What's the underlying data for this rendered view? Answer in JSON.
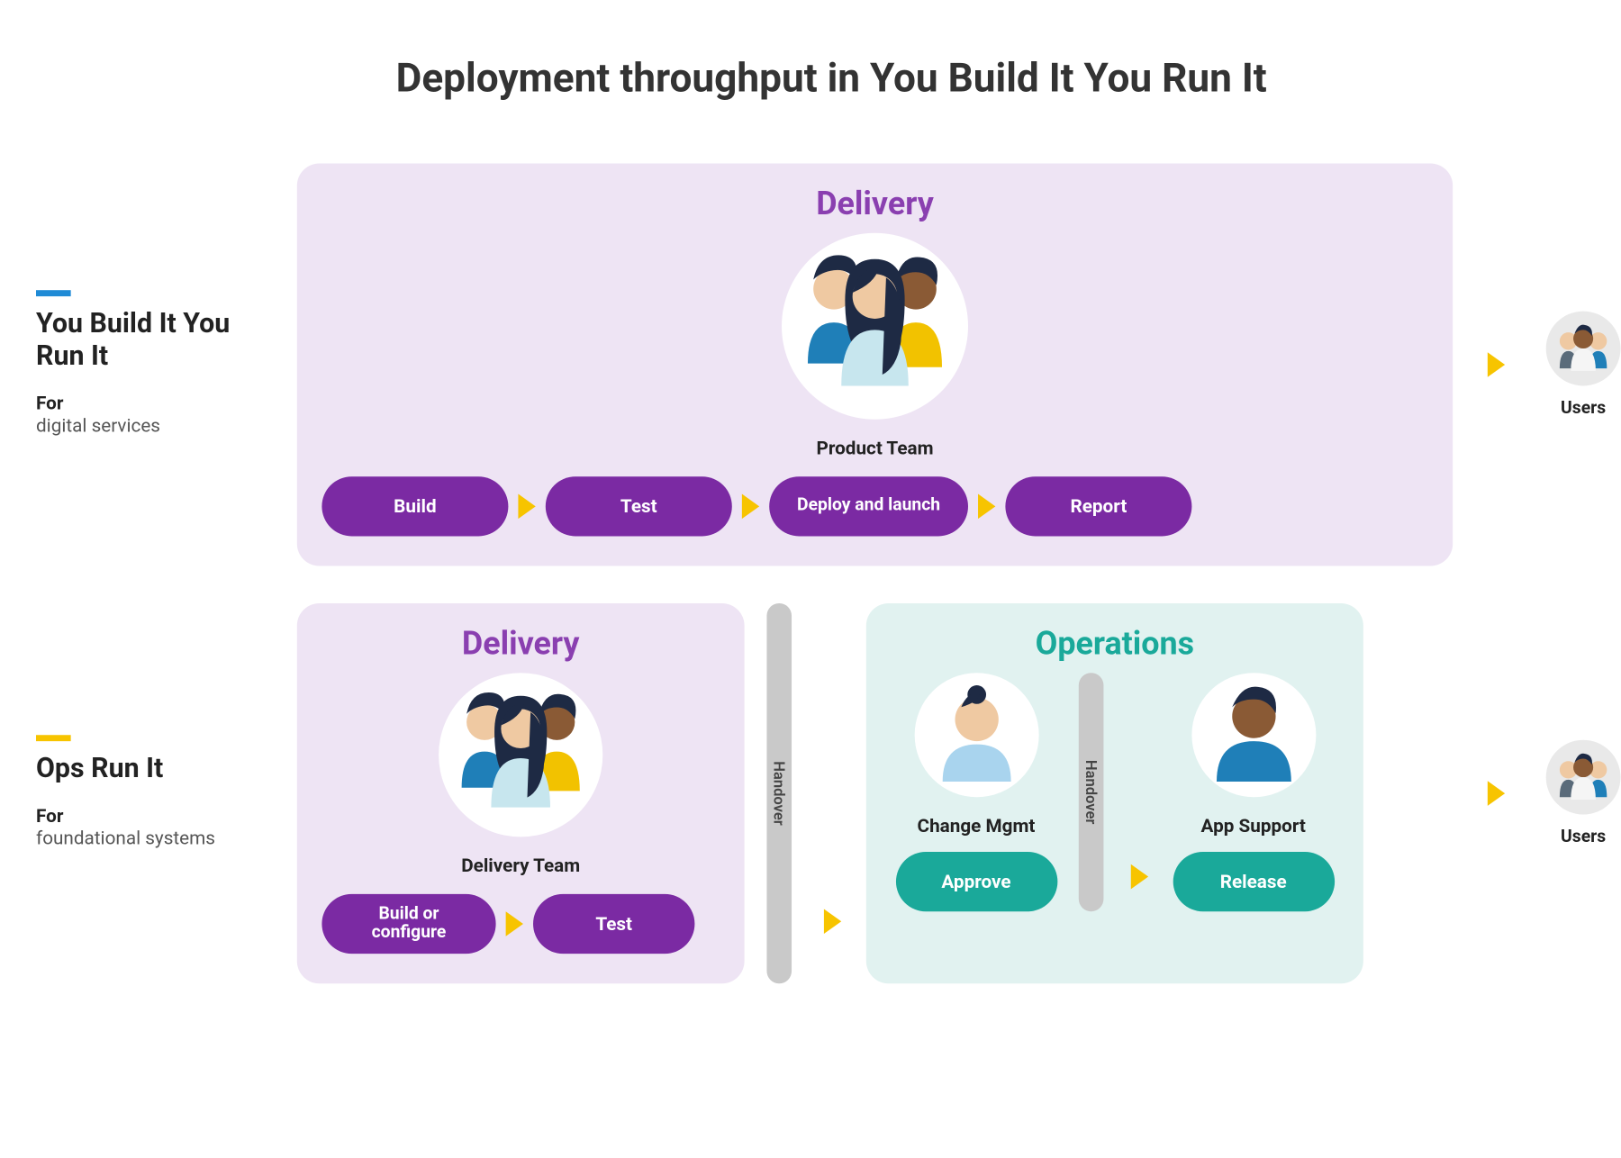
{
  "title": "Deployment throughput in You Build It You Run It",
  "models": [
    {
      "accent": "blue",
      "name": "You Build It You Run It",
      "for_label": "For",
      "for_value": "digital services"
    },
    {
      "accent": "yellow",
      "name": "Ops Run It",
      "for_label": "For",
      "for_value": "foundational systems"
    }
  ],
  "row1": {
    "delivery": {
      "title": "Delivery",
      "team_label": "Product Team",
      "steps": [
        "Build",
        "Test",
        "Deploy and launch",
        "Report"
      ]
    },
    "users_label": "Users"
  },
  "row2": {
    "delivery": {
      "title": "Delivery",
      "team_label": "Delivery Team",
      "steps": [
        "Build or configure",
        "Test"
      ]
    },
    "handover_label": "Handover",
    "operations": {
      "title": "Operations",
      "change": {
        "label": "Change Mgmt",
        "step": "Approve"
      },
      "handover_label": "Handover",
      "support": {
        "label": "App Support",
        "step": "Release"
      }
    },
    "users_label": "Users"
  }
}
